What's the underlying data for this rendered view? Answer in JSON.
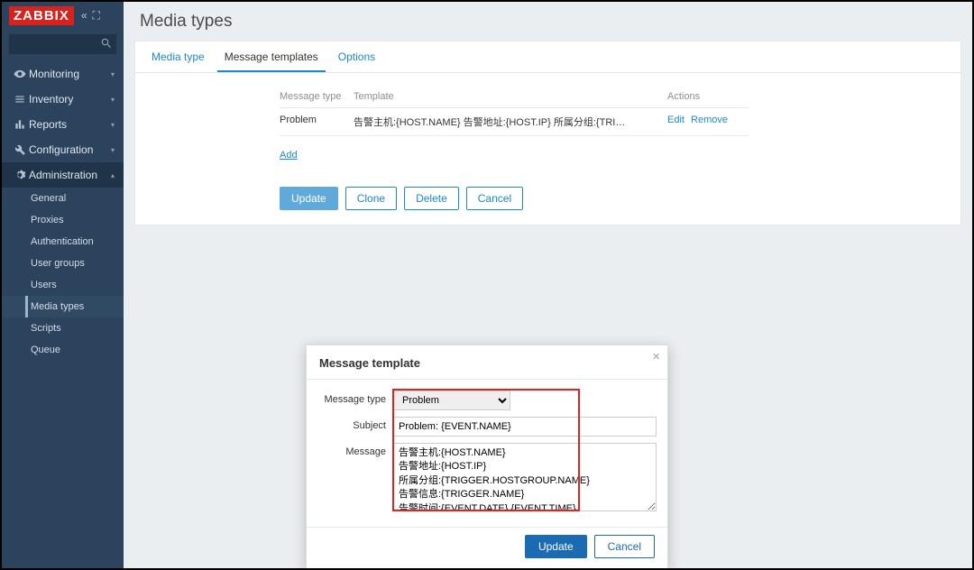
{
  "logo": "ZABBIX",
  "search": {
    "placeholder": ""
  },
  "nav": [
    {
      "icon": "eye",
      "label": "Monitoring"
    },
    {
      "icon": "list",
      "label": "Inventory"
    },
    {
      "icon": "bar",
      "label": "Reports"
    },
    {
      "icon": "wrench",
      "label": "Configuration"
    },
    {
      "icon": "gear",
      "label": "Administration"
    }
  ],
  "sub": [
    "General",
    "Proxies",
    "Authentication",
    "User groups",
    "Users",
    "Media types",
    "Scripts",
    "Queue"
  ],
  "page_title": "Media types",
  "tabs": [
    "Media type",
    "Message templates",
    "Options"
  ],
  "table": {
    "headers": [
      "Message type",
      "Template",
      "Actions"
    ],
    "row": {
      "type": "Problem",
      "template": "告警主机:{HOST.NAME} 告警地址:{HOST.IP} 所属分组:{TRI…",
      "edit": "Edit",
      "remove": "Remove"
    },
    "add": "Add"
  },
  "buttons": {
    "update": "Update",
    "clone": "Clone",
    "delete": "Delete",
    "cancel": "Cancel"
  },
  "modal": {
    "title": "Message template",
    "labels": {
      "msgtype": "Message type",
      "subject": "Subject",
      "message": "Message"
    },
    "msgtype_value": "Problem",
    "subject_value": "Problem: {EVENT.NAME}",
    "message_value": "告警主机:{HOST.NAME}\n告警地址:{HOST.IP}\n所属分组:{TRIGGER.HOSTGROUP.NAME}\n告警信息:{TRIGGER.NAME}\n告警时间:{EVENT.DATE} {EVENT.TIME}\n事件ID:{EVENT.ID}",
    "update": "Update",
    "cancel": "Cancel"
  }
}
